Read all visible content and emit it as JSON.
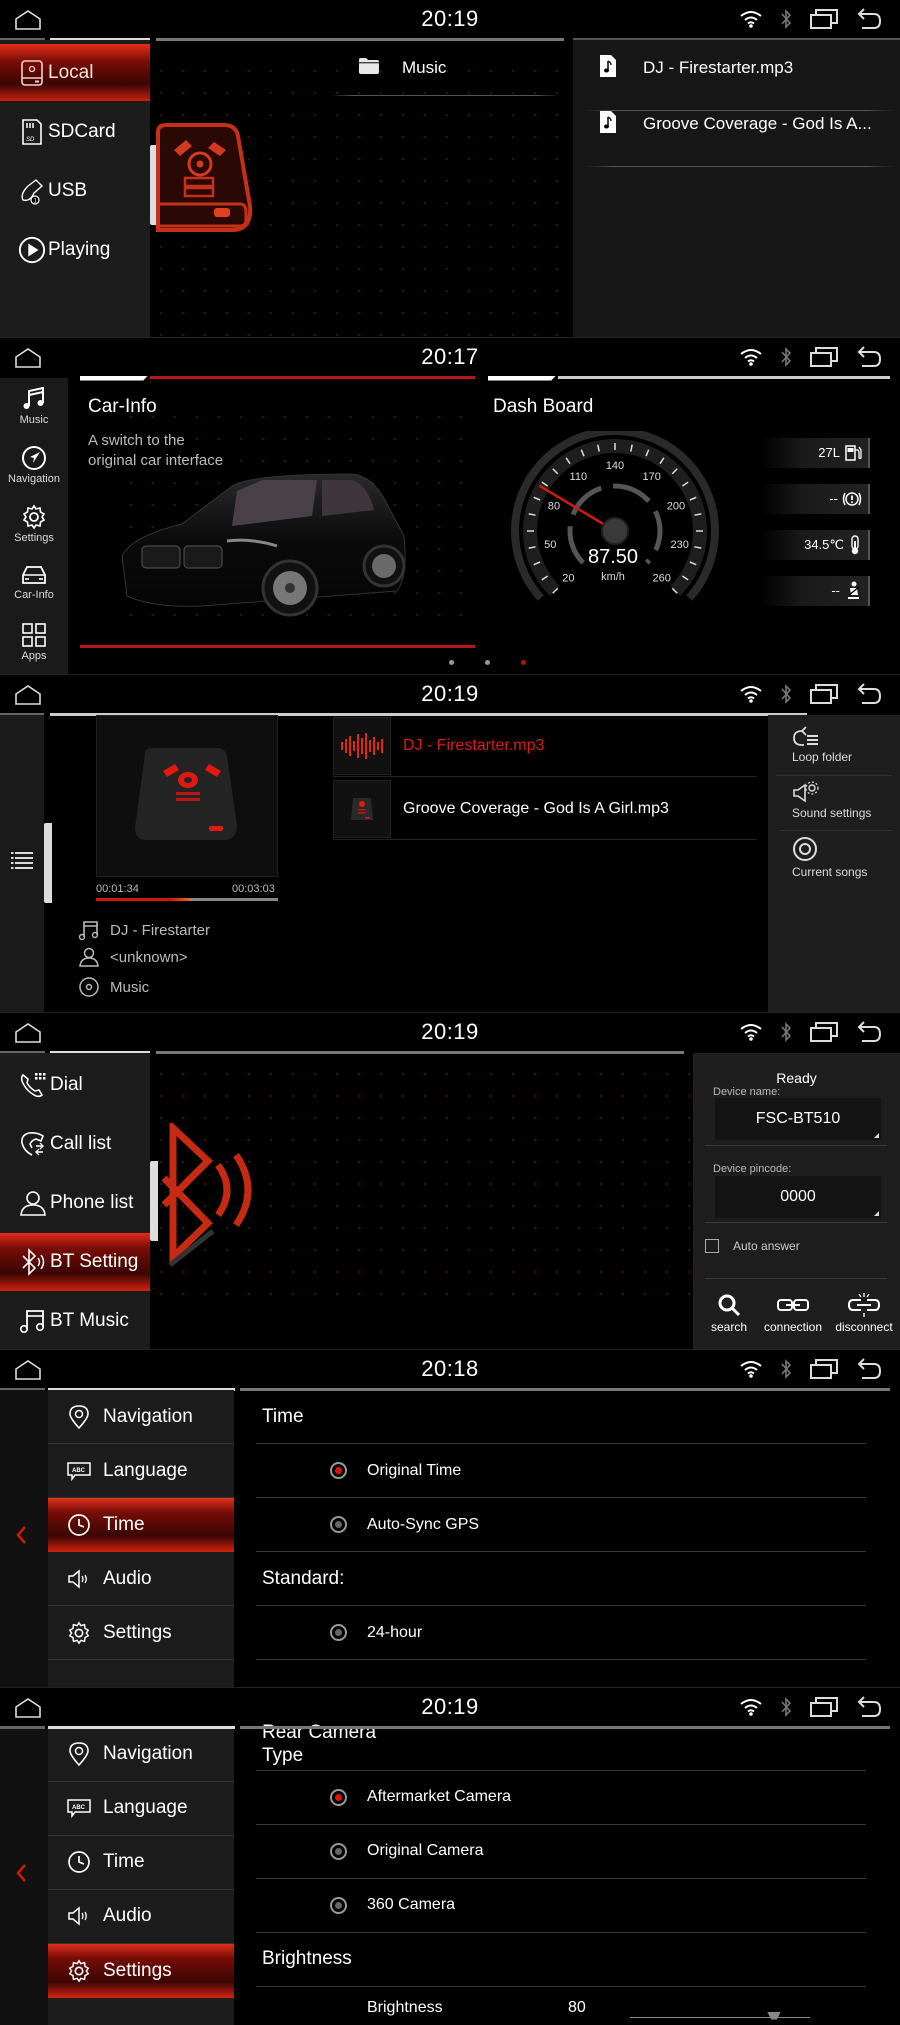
{
  "screens": {
    "media": {
      "clock": "20:19",
      "sources": [
        {
          "label": "Local",
          "icon": "hard-drive-icon",
          "active": true
        },
        {
          "label": "SDCard",
          "icon": "sd-card-icon",
          "active": false
        },
        {
          "label": "USB",
          "icon": "usb-icon",
          "active": false
        },
        {
          "label": "Playing",
          "icon": "play-circle-icon",
          "active": false
        }
      ],
      "folder": {
        "label": "Music",
        "icon": "folder-icon"
      },
      "files": [
        {
          "name": "DJ - Firestarter.mp3",
          "icon": "music-file-icon"
        },
        {
          "name": "Groove Coverage - God Is A...",
          "icon": "music-file-icon"
        }
      ]
    },
    "home": {
      "clock": "20:17",
      "nav": [
        {
          "label": "Music",
          "icon": "music-note-icon"
        },
        {
          "label": "Navigation",
          "icon": "compass-icon"
        },
        {
          "label": "Settings",
          "icon": "gear-icon"
        },
        {
          "label": "Car-Info",
          "icon": "car-icon"
        },
        {
          "label": "Apps",
          "icon": "apps-grid-icon"
        }
      ],
      "car_info": {
        "title": "Car-Info",
        "line1": "A switch to the",
        "line2": "original car interface"
      },
      "dashboard": {
        "title": "Dash Board",
        "speed": "87.50",
        "unit": "km/h",
        "speed_ticks": [
          "20",
          "50",
          "80",
          "110",
          "140",
          "170",
          "200",
          "230",
          "260"
        ],
        "readouts": [
          {
            "value": "27L",
            "icon": "fuel-pump-icon"
          },
          {
            "value": "--",
            "icon": "brake-warning-icon"
          },
          {
            "value": "34.5℃",
            "icon": "thermometer-icon"
          },
          {
            "value": "--",
            "icon": "seatbelt-icon"
          }
        ]
      },
      "page_dots": {
        "count": 3,
        "active": 3
      }
    },
    "player": {
      "clock": "20:19",
      "elapsed": "00:01:34",
      "duration": "00:03:03",
      "progress": 0.51,
      "title": "DJ - Firestarter",
      "artist": "<unknown>",
      "album": "Music",
      "songs": [
        {
          "name": "DJ - Firestarter.mp3",
          "playing": true
        },
        {
          "name": "Groove Coverage - God Is A Girl.mp3",
          "playing": false
        }
      ],
      "menu": [
        {
          "label": "Loop folder",
          "icon": "loop-folder-icon"
        },
        {
          "label": "Sound settings",
          "icon": "sound-settings-icon"
        },
        {
          "label": "Current songs",
          "icon": "target-icon"
        }
      ]
    },
    "bluetooth": {
      "clock": "20:19",
      "menu": [
        {
          "label": "Dial",
          "icon": "dial-icon",
          "active": false
        },
        {
          "label": "Call list",
          "icon": "call-list-icon",
          "active": false
        },
        {
          "label": "Phone list",
          "icon": "contact-icon",
          "active": false
        },
        {
          "label": "BT Setting",
          "icon": "bluetooth-icon",
          "active": true
        },
        {
          "label": "BT Music",
          "icon": "music-note-icon",
          "active": false
        }
      ],
      "status": "Ready",
      "device_name_label": "Device name:",
      "device_name": "FSC-BT510",
      "pincode_label": "Device pincode:",
      "pincode": "0000",
      "auto_answer_label": "Auto answer",
      "auto_answer": false,
      "actions": [
        {
          "label": "search",
          "icon": "search-icon"
        },
        {
          "label": "connection",
          "icon": "link-icon"
        },
        {
          "label": "disconnect",
          "icon": "unlink-icon"
        }
      ]
    },
    "time_settings": {
      "clock": "20:18",
      "menu": [
        {
          "label": "Navigation",
          "icon": "location-pin-icon",
          "active": false
        },
        {
          "label": "Language",
          "icon": "language-icon",
          "active": false
        },
        {
          "label": "Time",
          "icon": "clock-icon",
          "active": true
        },
        {
          "label": "Audio",
          "icon": "speaker-icon",
          "active": false
        },
        {
          "label": "Settings",
          "icon": "gear-icon",
          "active": false
        }
      ],
      "section1": "Time",
      "time_options": [
        {
          "label": "Original Time",
          "selected": true
        },
        {
          "label": "Auto-Sync GPS",
          "selected": false
        }
      ],
      "section2": "Standard:",
      "standard_options": [
        {
          "label": "24-hour",
          "selected": false
        }
      ]
    },
    "camera_settings": {
      "clock": "20:19",
      "menu": [
        {
          "label": "Navigation",
          "icon": "location-pin-icon",
          "active": false
        },
        {
          "label": "Language",
          "icon": "language-icon",
          "active": false
        },
        {
          "label": "Time",
          "icon": "clock-icon",
          "active": false
        },
        {
          "label": "Audio",
          "icon": "speaker-icon",
          "active": false
        },
        {
          "label": "Settings",
          "icon": "gear-icon",
          "active": true
        }
      ],
      "section1_line1": "Rear Camera",
      "section1_line2": "Type",
      "camera_options": [
        {
          "label": "Aftermarket Camera",
          "selected": true
        },
        {
          "label": "Original Camera",
          "selected": false
        },
        {
          "label": "360 Camera",
          "selected": false
        }
      ],
      "section2": "Brightness",
      "brightness_label": "Brightness",
      "brightness_value": "80",
      "brightness_level": 0.8
    }
  },
  "colors": {
    "accent": "#e01a10",
    "panel": "#1c1c1c",
    "background": "#000000"
  }
}
